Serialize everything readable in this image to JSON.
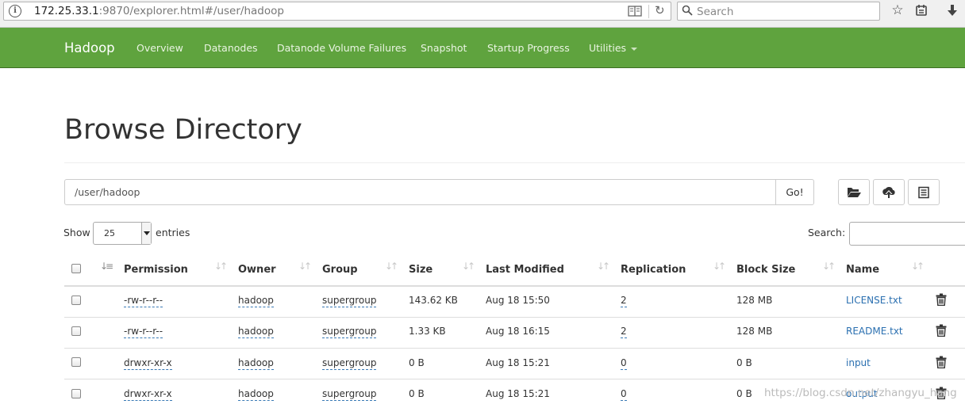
{
  "browser": {
    "url_host": "172.25.33.1",
    "url_rest": ":9870/explorer.html#/user/hadoop",
    "search_placeholder": "Search",
    "icons": [
      "info-icon",
      "reader-mode-icon",
      "reload-icon",
      "search-icon",
      "bookmark-star-icon",
      "library-icon",
      "download-icon"
    ]
  },
  "navbar": {
    "brand": "Hadoop",
    "links": [
      "Overview",
      "Datanodes",
      "Datanode Volume Failures",
      "Snapshot",
      "Startup Progress",
      "Utilities"
    ],
    "bg_color": "#5fa33e"
  },
  "page": {
    "title": "Browse Directory",
    "directory_value": "/user/hadoop",
    "go_label": "Go!",
    "toolbar_icons": [
      "folder-open-icon",
      "upload-icon",
      "list-icon"
    ],
    "show_label": "Show",
    "entries_value": "25",
    "entries_label": "entries",
    "search_label": "Search:"
  },
  "table": {
    "columns": [
      "Permission",
      "Owner",
      "Group",
      "Size",
      "Last Modified",
      "Replication",
      "Block Size",
      "Name"
    ],
    "rows": [
      {
        "permission": "-rw-r--r--",
        "owner": "hadoop",
        "group": "supergroup",
        "size": "143.62 KB",
        "modified": "Aug 18 15:50",
        "replication": "2",
        "block_size": "128 MB",
        "name": "LICENSE.txt"
      },
      {
        "permission": "-rw-r--r--",
        "owner": "hadoop",
        "group": "supergroup",
        "size": "1.33 KB",
        "modified": "Aug 18 16:15",
        "replication": "2",
        "block_size": "128 MB",
        "name": "README.txt"
      },
      {
        "permission": "drwxr-xr-x",
        "owner": "hadoop",
        "group": "supergroup",
        "size": "0 B",
        "modified": "Aug 18 15:21",
        "replication": "0",
        "block_size": "0 B",
        "name": "input"
      },
      {
        "permission": "drwxr-xr-x",
        "owner": "hadoop",
        "group": "supergroup",
        "size": "0 B",
        "modified": "Aug 18 15:21",
        "replication": "0",
        "block_size": "0 B",
        "name": "output"
      }
    ]
  },
  "watermark": "https://blog.csdn.net/zhangyu_hang"
}
